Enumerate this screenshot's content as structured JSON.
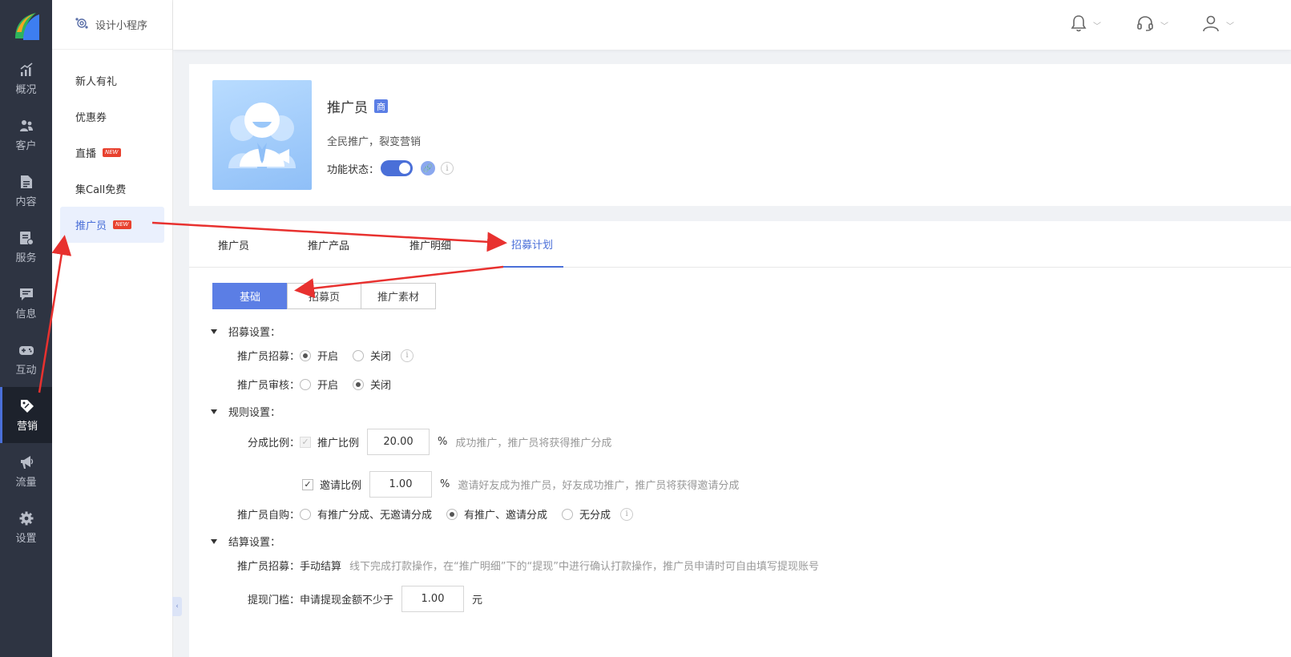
{
  "nav": {
    "items": [
      {
        "label": "概况",
        "icon": "chart-up-icon"
      },
      {
        "label": "客户",
        "icon": "users-icon"
      },
      {
        "label": "内容",
        "icon": "document-icon"
      },
      {
        "label": "服务",
        "icon": "service-icon"
      },
      {
        "label": "信息",
        "icon": "message-icon"
      },
      {
        "label": "互动",
        "icon": "gamepad-icon"
      },
      {
        "label": "营销",
        "icon": "tag-icon"
      },
      {
        "label": "流量",
        "icon": "megaphone-icon"
      },
      {
        "label": "设置",
        "icon": "gear-icon"
      }
    ],
    "active_index": 6
  },
  "sidebar": {
    "header": "设计小程序",
    "items": [
      {
        "label": "新人有礼"
      },
      {
        "label": "优惠券"
      },
      {
        "label": "直播",
        "badge": "NEW"
      },
      {
        "label": "集Call免费"
      },
      {
        "label": "推广员",
        "badge": "NEW"
      }
    ]
  },
  "card": {
    "title": "推广员",
    "tag": "商",
    "desc": "全民推广，裂变营销",
    "status_label": "功能状态：",
    "enabled": true
  },
  "tabs": [
    "推广员",
    "推广产品",
    "推广明细",
    "招募计划"
  ],
  "active_tab": 3,
  "subtabs": [
    "基础",
    "招募页",
    "推广素材"
  ],
  "recruit": {
    "section": "招募设置：",
    "recruit_label": "推广员招募：",
    "on": "开启",
    "off": "关闭",
    "review_label": "推广员审核："
  },
  "rules": {
    "section": "规则设置：",
    "split_label": "分成比例：",
    "promo_label": "推广比例",
    "promo_value": "20.00",
    "percent": "%",
    "promo_hint": "成功推广，推广员将获得推广分成",
    "invite_label": "邀请比例",
    "invite_value": "1.00",
    "invite_hint": "邀请好友成为推广员，好友成功推广，推广员将获得邀请分成",
    "self_label": "推广员自购：",
    "self_opt1": "有推广分成、无邀请分成",
    "self_opt2": "有推广、邀请分成",
    "self_opt3": "无分成"
  },
  "settle": {
    "section": "结算设置：",
    "recruit_label": "推广员招募：",
    "mode": "手动结算",
    "mode_hint": "线下完成打款操作，在“推广明细”下的“提现”中进行确认打款操作，推广员申请时可自由填写提现账号",
    "threshold_label": "提现门槛：",
    "threshold_text": "申请提现金额不少于",
    "threshold_value": "1.00",
    "unit": "元"
  },
  "colors": {
    "nav_bg": "#2e3442",
    "accent": "#4a6fd8",
    "annotation": "#e8312f"
  }
}
